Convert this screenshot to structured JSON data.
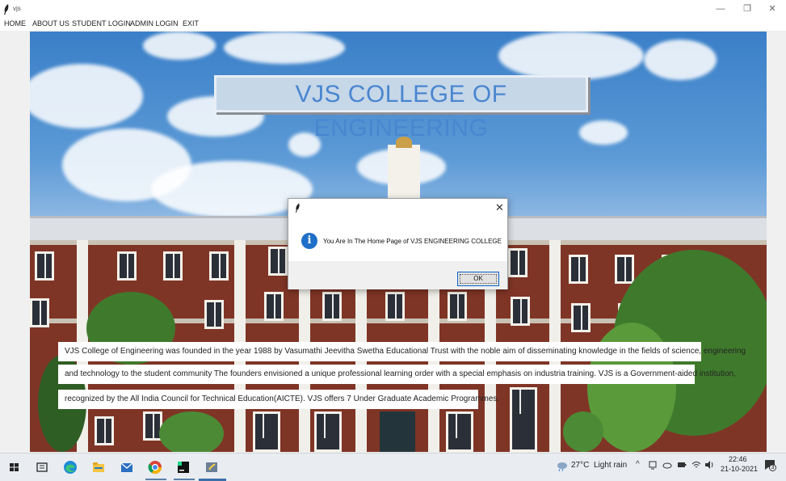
{
  "window": {
    "title": "vjs",
    "minimize": "—",
    "maximize": "❐",
    "close": "✕"
  },
  "menu": {
    "items": [
      "HOME",
      "ABOUT US",
      "STUDENT LOGIN",
      "ADMIN LOGIN",
      "EXIT"
    ]
  },
  "banner": {
    "title": "VJS COLLEGE OF ENGINEERING"
  },
  "description": {
    "lines": [
      "VJS College of Engineering was founded in the year 1988 by Vasumathi Jeevitha Swetha Educational Trust with the noble aim of disseminating knowledge in the fields of science, engineering",
      "and technology to the student community The founders envisioned a unique professional learning order with a special emphasis on industria training. VJS is a Government-aided institution,",
      "recognized by the All India Council for Technical Education(AICTE). VJS offers 7 Under Graduate Academic Programmes."
    ]
  },
  "dialog": {
    "close": "✕",
    "icon_glyph": "i",
    "message": "You Are In The Home Page of VJS ENGINEERING COLLEGE",
    "ok_label": "OK"
  },
  "taskbar": {
    "icons": [
      "windows-start-icon",
      "task-view-icon",
      "edge-icon",
      "file-explorer-icon",
      "mail-icon",
      "chrome-icon",
      "pycharm-icon",
      "python-tk-icon"
    ],
    "weather": {
      "temperature": "27°C",
      "condition": "Light rain"
    },
    "tray": {
      "chevron": "^",
      "time": "22:46",
      "date": "21-10-2021",
      "notification_count": "3"
    }
  },
  "colors": {
    "banner_text": "#4a86d0",
    "banner_bg": "#c6d7e8",
    "info_blue": "#1f6fc8",
    "brick": "#7f3526"
  }
}
